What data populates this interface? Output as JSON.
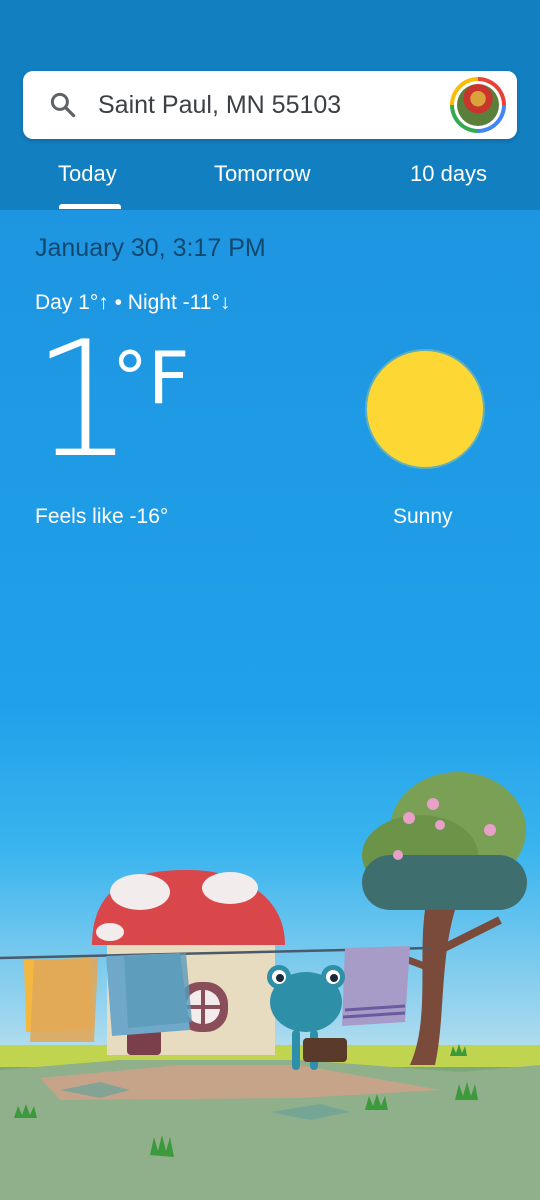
{
  "search": {
    "location": "Saint Paul, MN 55103"
  },
  "tabs": [
    {
      "label": "Today"
    },
    {
      "label": "Tomorrow"
    },
    {
      "label": "10 days"
    }
  ],
  "weather": {
    "datetime": "January 30, 3:17 PM",
    "day_night": "Day 1°↑ • Night -11°↓",
    "temperature": "1",
    "unit": "°F",
    "feels_like": "Feels like -16°",
    "condition": "Sunny"
  },
  "colors": {
    "header": "#127fc0",
    "sky": "#1e95e0",
    "sun": "#fdd835"
  },
  "icons": {
    "search": "search-icon",
    "condition": "sun-icon"
  }
}
